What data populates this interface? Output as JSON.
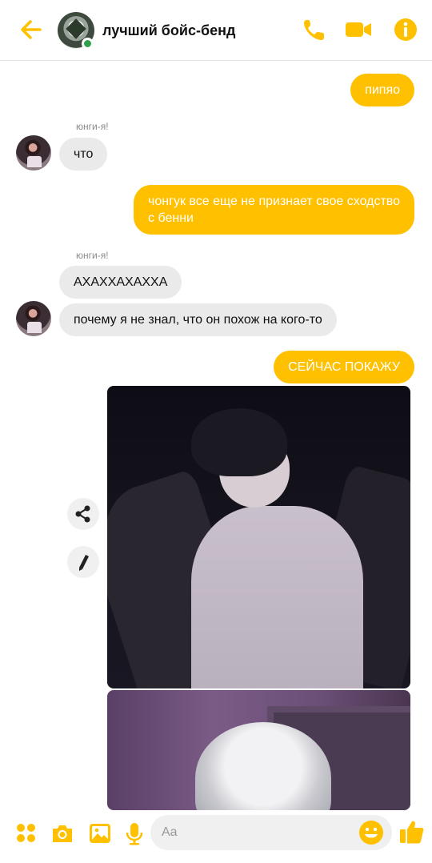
{
  "header": {
    "title": "лучший бойс-бенд",
    "back_icon": "arrow-left-icon",
    "call_icon": "phone-icon",
    "video_icon": "video-camera-icon",
    "info_icon": "info-icon",
    "accent": "#ffc000",
    "online_status_color": "#31a24c"
  },
  "messages": [
    {
      "type": "outgoing",
      "text": "пипяо"
    },
    {
      "type": "incoming",
      "sender": "юнги-я!",
      "text": "что"
    },
    {
      "type": "outgoing",
      "text": "чонгук все еще не признает свое сходство\nс бенни"
    },
    {
      "type": "incoming",
      "sender": "юнги-я!",
      "text": "АХАХХАХАХХА"
    },
    {
      "type": "incoming",
      "text": "почему я не знал, что он похож на кого-то"
    },
    {
      "type": "outgoing",
      "text": "СЕЙЧАС ПОКАЖУ"
    }
  ],
  "photo_actions": {
    "share_icon": "share-icon",
    "edit_icon": "pencil-icon"
  },
  "composer": {
    "placeholder": "Aa",
    "icons": [
      "grid-menu-icon",
      "camera-icon",
      "image-icon",
      "microphone-icon",
      "emoji-icon",
      "thumbs-up-icon"
    ]
  }
}
